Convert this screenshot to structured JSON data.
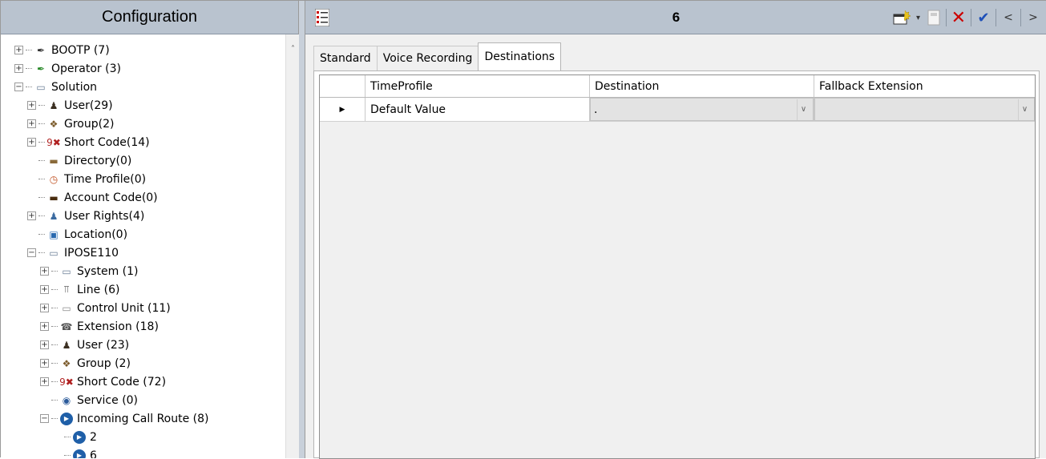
{
  "left_header": {
    "title": "Configuration"
  },
  "tree": [
    {
      "label": "BOOTP (7)",
      "icon": "bootp-icon",
      "level": 0,
      "exp": "+"
    },
    {
      "label": "Operator (3)",
      "icon": "operator-icon",
      "level": 0,
      "exp": "+"
    },
    {
      "label": "Solution",
      "icon": "solution-icon",
      "level": 0,
      "exp": "-"
    },
    {
      "label": "User(29)",
      "icon": "user-icon",
      "level": 1,
      "exp": "+"
    },
    {
      "label": "Group(2)",
      "icon": "group-icon",
      "level": 1,
      "exp": "+"
    },
    {
      "label": "Short Code(14)",
      "icon": "short-code-icon",
      "level": 1,
      "exp": "+"
    },
    {
      "label": "Directory(0)",
      "icon": "directory-icon",
      "level": 1,
      "exp": ""
    },
    {
      "label": "Time Profile(0)",
      "icon": "time-profile-icon",
      "level": 1,
      "exp": ""
    },
    {
      "label": "Account Code(0)",
      "icon": "account-code-icon",
      "level": 1,
      "exp": ""
    },
    {
      "label": "User Rights(4)",
      "icon": "user-rights-icon",
      "level": 1,
      "exp": "+"
    },
    {
      "label": "Location(0)",
      "icon": "location-icon",
      "level": 1,
      "exp": ""
    },
    {
      "label": "IPOSE110",
      "icon": "system-icon",
      "level": 1,
      "exp": "-"
    },
    {
      "label": "System (1)",
      "icon": "system-icon",
      "level": 2,
      "exp": "+"
    },
    {
      "label": "Line (6)",
      "icon": "line-icon",
      "level": 2,
      "exp": "+"
    },
    {
      "label": "Control Unit (11)",
      "icon": "control-unit-icon",
      "level": 2,
      "exp": "+"
    },
    {
      "label": "Extension (18)",
      "icon": "extension-icon",
      "level": 2,
      "exp": "+"
    },
    {
      "label": "User (23)",
      "icon": "user-icon",
      "level": 2,
      "exp": "+"
    },
    {
      "label": "Group (2)",
      "icon": "group-icon",
      "level": 2,
      "exp": "+"
    },
    {
      "label": "Short Code (72)",
      "icon": "short-code-icon",
      "level": 2,
      "exp": "+"
    },
    {
      "label": "Service (0)",
      "icon": "service-icon",
      "level": 2,
      "exp": ""
    },
    {
      "label": "Incoming Call Route (8)",
      "icon": "incoming-call-route-icon",
      "level": 2,
      "exp": "-"
    },
    {
      "label": "2",
      "icon": "incoming-call-route-icon",
      "level": 3,
      "exp": ""
    },
    {
      "label": "6",
      "icon": "incoming-call-route-icon",
      "level": 3,
      "exp": ""
    }
  ],
  "right_header": {
    "title": "6"
  },
  "tabs": [
    {
      "label": "Standard"
    },
    {
      "label": "Voice Recording"
    },
    {
      "label": "Destinations",
      "active": true
    }
  ],
  "grid": {
    "columns": [
      "TimeProfile",
      "Destination",
      "Fallback Extension"
    ],
    "rows": [
      {
        "indicator": "▶",
        "time_profile": "Default Value",
        "destination": ".",
        "fallback": ""
      }
    ]
  }
}
